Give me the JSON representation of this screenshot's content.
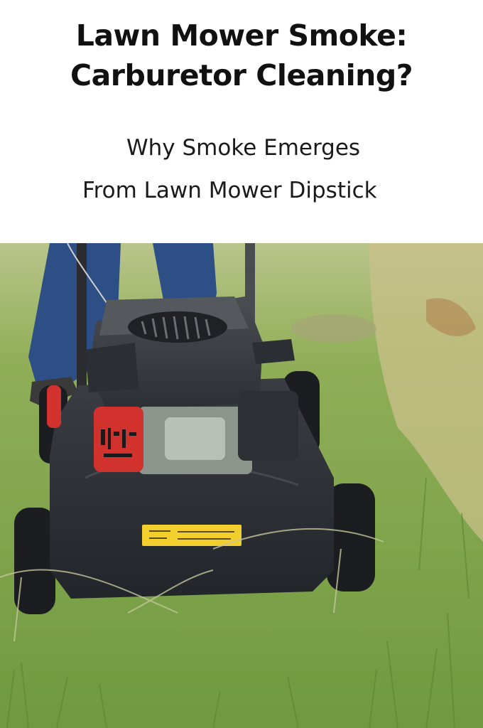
{
  "title": {
    "line1": "Lawn Mower Smoke:",
    "line2": "Carburetor Cleaning?"
  },
  "subtitle": {
    "line1": "Why Smoke Emerges",
    "line2": "From Lawn Mower Dipstick"
  },
  "photo": {
    "colors": {
      "grass": "#7fa34a",
      "mower_body": "#2f3237",
      "fuel_tank": "#d2322e",
      "label": "#f2cf2d",
      "jeans": "#2d4f86"
    }
  }
}
